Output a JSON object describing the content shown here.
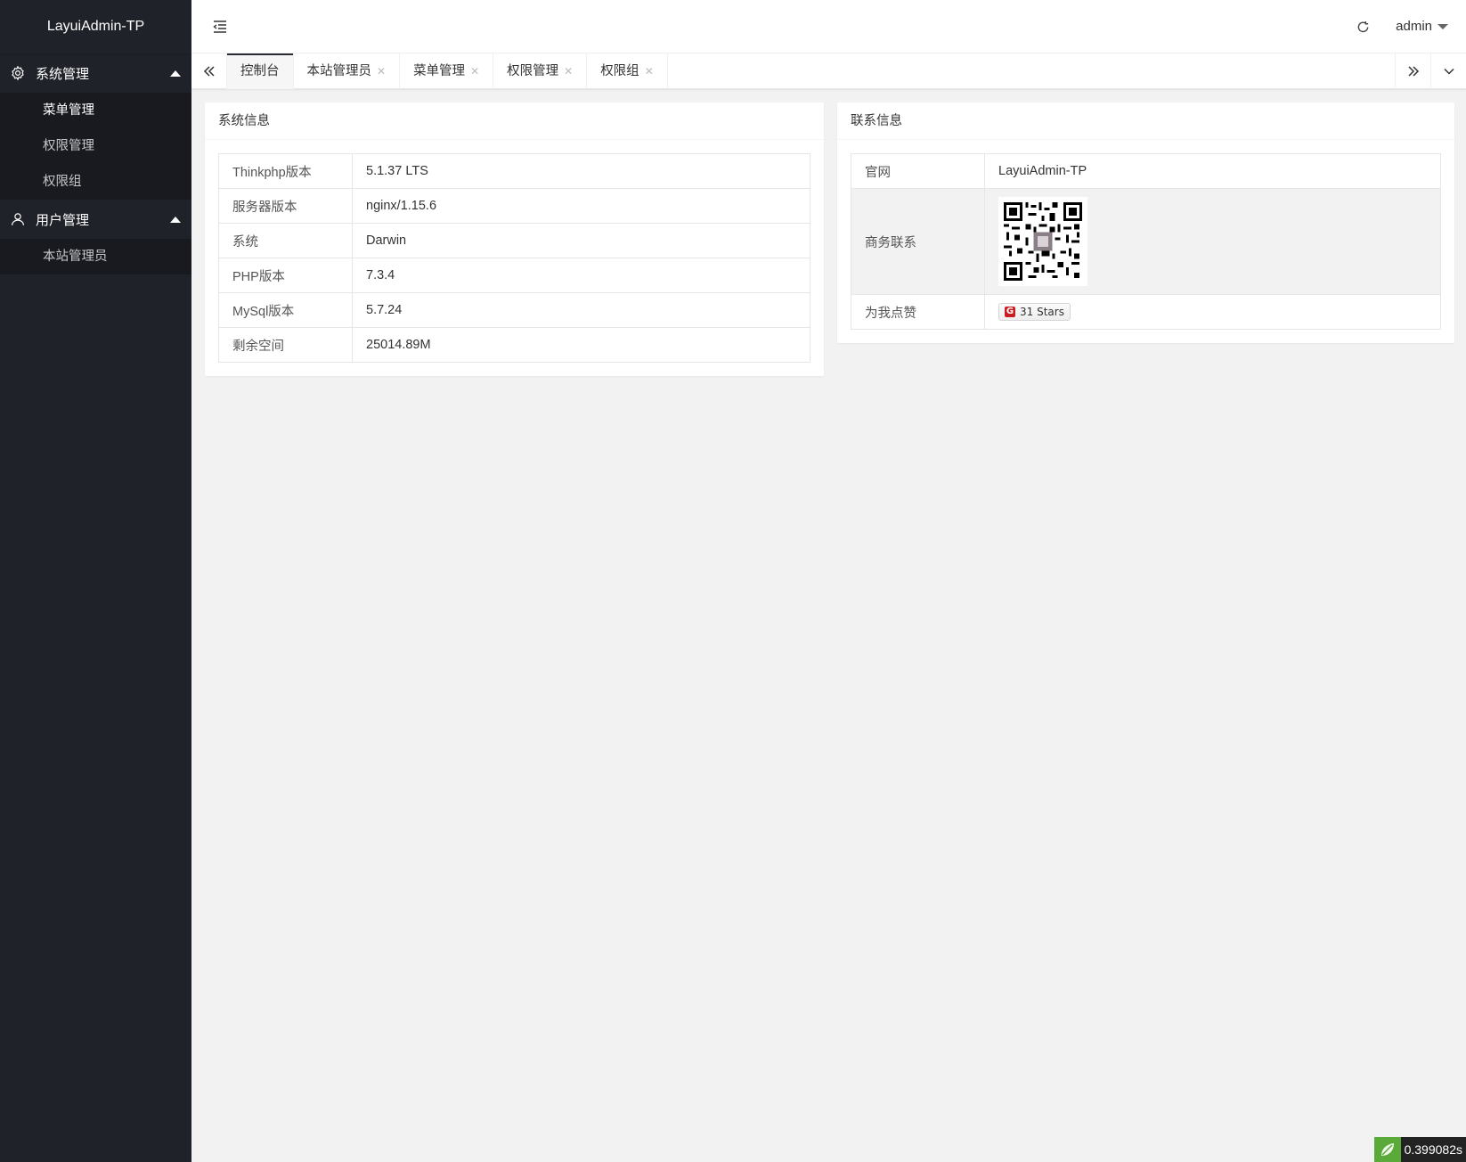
{
  "app": {
    "title": "LayuiAdmin-TP"
  },
  "sidebar": {
    "groups": [
      {
        "label": "系统管理",
        "icon": "gear-icon",
        "children": [
          {
            "label": "菜单管理"
          },
          {
            "label": "权限管理"
          },
          {
            "label": "权限组"
          }
        ]
      },
      {
        "label": "用户管理",
        "icon": "user-icon",
        "children": [
          {
            "label": "本站管理员"
          }
        ]
      }
    ]
  },
  "header": {
    "user": "admin"
  },
  "tabs": [
    {
      "label": "控制台"
    },
    {
      "label": "本站管理员"
    },
    {
      "label": "菜单管理"
    },
    {
      "label": "权限管理"
    },
    {
      "label": "权限组"
    }
  ],
  "system_info": {
    "title": "系统信息",
    "rows": [
      {
        "key": "Thinkphp版本",
        "value": "5.1.37 LTS"
      },
      {
        "key": "服务器版本",
        "value": "nginx/1.15.6"
      },
      {
        "key": "系统",
        "value": "Darwin"
      },
      {
        "key": "PHP版本",
        "value": "7.3.4"
      },
      {
        "key": "MySql版本",
        "value": "5.7.24"
      },
      {
        "key": "剩余空间",
        "value": "25014.89M"
      }
    ]
  },
  "contact_info": {
    "title": "联系信息",
    "website_key": "官网",
    "website_value": "LayuiAdmin-TP",
    "business_key": "商务联系",
    "like_key": "为我点赞",
    "stars": "31 Stars"
  },
  "timer": "0.399082s",
  "colors": {
    "sidebar_bg": "#20222a",
    "sidebar_child_bg": "#181a20",
    "page_bg": "#f2f2f2",
    "gitee_red": "#c71d23"
  }
}
